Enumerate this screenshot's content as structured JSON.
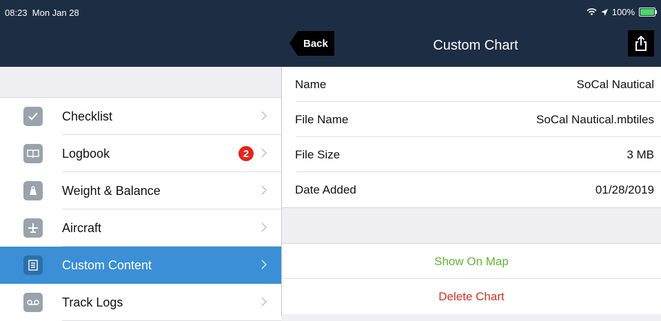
{
  "status_bar": {
    "time": "08:23",
    "date": "Mon Jan 28",
    "battery": "100%"
  },
  "nav": {
    "back_label": "Back",
    "title": "Custom Chart"
  },
  "sidebar": {
    "items": [
      {
        "label": "Checklist",
        "icon": "checklist-icon"
      },
      {
        "label": "Logbook",
        "icon": "logbook-icon",
        "badge": "2"
      },
      {
        "label": "Weight & Balance",
        "icon": "weight-icon"
      },
      {
        "label": "Aircraft",
        "icon": "airplane-icon"
      },
      {
        "label": "Custom Content",
        "icon": "document-icon",
        "selected": true
      },
      {
        "label": "Track Logs",
        "icon": "track-icon"
      }
    ]
  },
  "details": [
    {
      "key": "Name",
      "value": "SoCal Nautical"
    },
    {
      "key": "File Name",
      "value": "SoCal Nautical.mbtiles"
    },
    {
      "key": "File Size",
      "value": "3 MB"
    },
    {
      "key": "Date Added",
      "value": "01/28/2019"
    }
  ],
  "actions": {
    "show_on_map": "Show On Map",
    "delete_chart": "Delete Chart"
  },
  "colors": {
    "green": "#5cb82c",
    "red": "#d63024",
    "selected": "#3a8fd6",
    "navbar": "#1d2d44"
  }
}
